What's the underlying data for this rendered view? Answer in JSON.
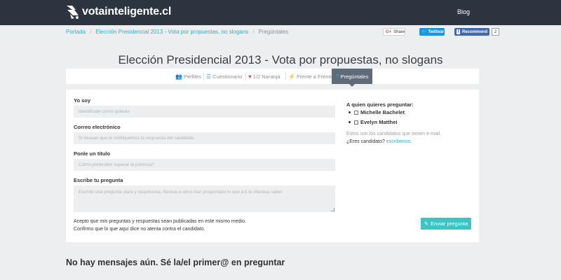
{
  "header": {
    "logo_text": "votainteligente.cl",
    "nav_blog": "Blog"
  },
  "breadcrumb": {
    "items": [
      "Portada",
      "Elección Presidencial 2013 - Vota por propuestas, no slogans"
    ],
    "current": "Pregúntales"
  },
  "social": {
    "google_share": "Share",
    "twitter": "Twittear",
    "facebook": "Recommend",
    "facebook_count": "2"
  },
  "page_title": "Elección Presidencial 2013 - Vota por propuestas, no slogans",
  "tabs": [
    {
      "label": "Perfiles",
      "icon": "users-icon",
      "glyph": "👥"
    },
    {
      "label": "Cuestionario",
      "icon": "list-icon",
      "glyph": "☰"
    },
    {
      "label": "1/2 Naranja",
      "icon": "heart-icon",
      "glyph": "♥"
    },
    {
      "label": "Frente a Frente",
      "icon": "bolt-icon",
      "glyph": "⚡"
    },
    {
      "label": "Pregúntales",
      "icon": "question-icon",
      "glyph": "?"
    }
  ],
  "form": {
    "yo_soy_label": "Yo soy",
    "yo_soy_placeholder": "Identifícate como quieras",
    "email_label": "Correo electrónico",
    "email_placeholder": "Si deseas que te notifiquemos la respuesta del candidato",
    "title_label": "Ponle un título",
    "title_placeholder": "Cómo pretenden superar la pobreza?",
    "question_label": "Escribe tu pregunta",
    "question_placeholder": "Escribe una pregunta clara y respetuosa. Revisa si otros han preguntado lo que a ti te interesa saber",
    "accept_line1": "Acepto que mis preguntas y respuestas sean publicadas en este mismo medio.",
    "accept_line2": "Confirmo que lo que aquí dice no atenta contra el candidato.",
    "send_button": "Enviar pregunta"
  },
  "sidebar": {
    "title": "A quien quieres preguntar:",
    "candidates": [
      "Michelle Bachelet",
      "Evelyn Matthei"
    ],
    "note": "Estos son los candidatos que tienen e-mail.",
    "candidate_prompt": "¿Eres candidato?",
    "candidate_link": "escríbenos"
  },
  "empty_message": "No hay mensajes aún. Sé la/el primer@ en preguntar",
  "colors": {
    "topbar": "#2c3440",
    "accent": "#2bb3c3",
    "button": "#3cc5c5",
    "active_tab": "#5f6b78"
  }
}
